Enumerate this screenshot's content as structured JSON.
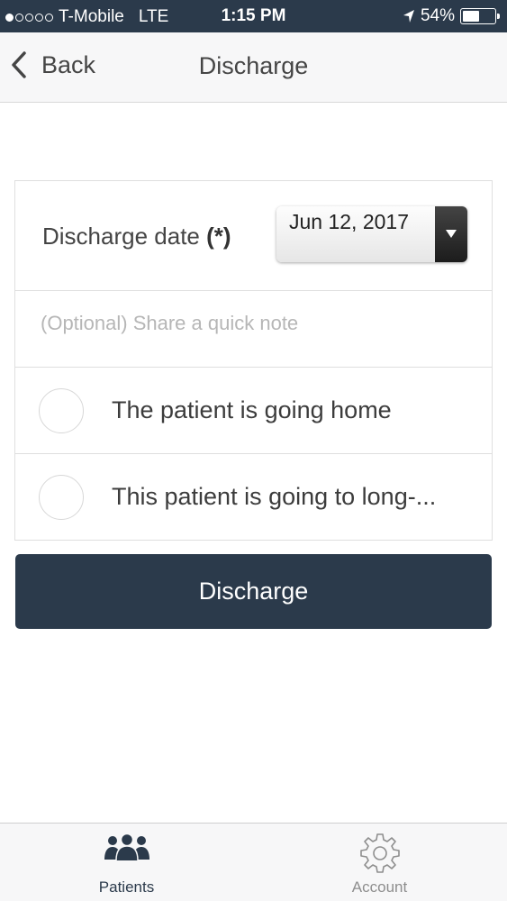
{
  "status_bar": {
    "carrier": "T-Mobile",
    "network": "LTE",
    "time": "1:15 PM",
    "battery_text": "54%",
    "battery_level": 0.54,
    "signal_bars": 1,
    "signal_total": 5
  },
  "nav": {
    "back_label": "Back",
    "title": "Discharge"
  },
  "form": {
    "date_label": "Discharge date",
    "date_required": "(*)",
    "date_value": "Jun 12, 2017",
    "note_placeholder": "(Optional) Share a quick note",
    "note_value": "",
    "options": [
      {
        "label": "The patient is going home",
        "selected": false
      },
      {
        "label": "This patient is going to long-...",
        "selected": false
      }
    ],
    "submit_label": "Discharge"
  },
  "tab_bar": {
    "tabs": [
      {
        "label": "Patients",
        "icon": "patients-icon",
        "active": true
      },
      {
        "label": "Account",
        "icon": "gear-icon",
        "active": false
      }
    ]
  },
  "colors": {
    "primary": "#2b3a4b",
    "border": "#dfdfdf",
    "placeholder": "#b6b6b6",
    "inactive_tab": "#8e8e8e"
  }
}
